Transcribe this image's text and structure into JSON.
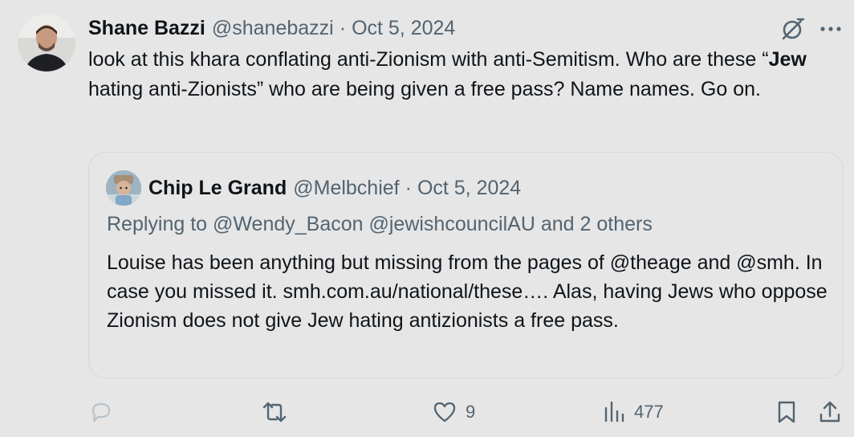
{
  "tweet": {
    "author_name": "Shane Bazzi",
    "handle": "@shanebazzi",
    "separator": "·",
    "date": "Oct 5, 2024",
    "text_before_bold": "look at this khara conflating anti-Zionism with anti-Semitism. Who are these “",
    "text_bold": "Jew",
    "text_after_bold": " hating anti-Zionists” who are being given a free pass? Name names. Go on."
  },
  "quoted_tweet": {
    "author_name": "Chip Le Grand",
    "handle": "@Melbchief",
    "separator": "·",
    "date": "Oct 5, 2024",
    "replying_to": "Replying to @Wendy_Bacon @jewishcouncilAU and 2 others",
    "text": "Louise has been anything but missing from the pages of @theage and @smh. In case you missed it. smh.com.au/national/these…. Alas, having Jews who oppose Zionism does not give Jew hating antizionists a free pass."
  },
  "actions": {
    "reply_icon": "speech-bubble-icon",
    "retweet_icon": "retweet-arrows-icon",
    "like_icon": "heart-icon",
    "like_count": "9",
    "views_icon": "bar-chart-icon",
    "views_count": "477",
    "bookmark_icon": "bookmark-icon",
    "share_icon": "share-upload-icon"
  },
  "colors": {
    "background": "#e6e6e6",
    "text": "#0f1419",
    "muted": "#536471",
    "reply_faded": "#b9c3cb",
    "border": "#cfd9de"
  }
}
